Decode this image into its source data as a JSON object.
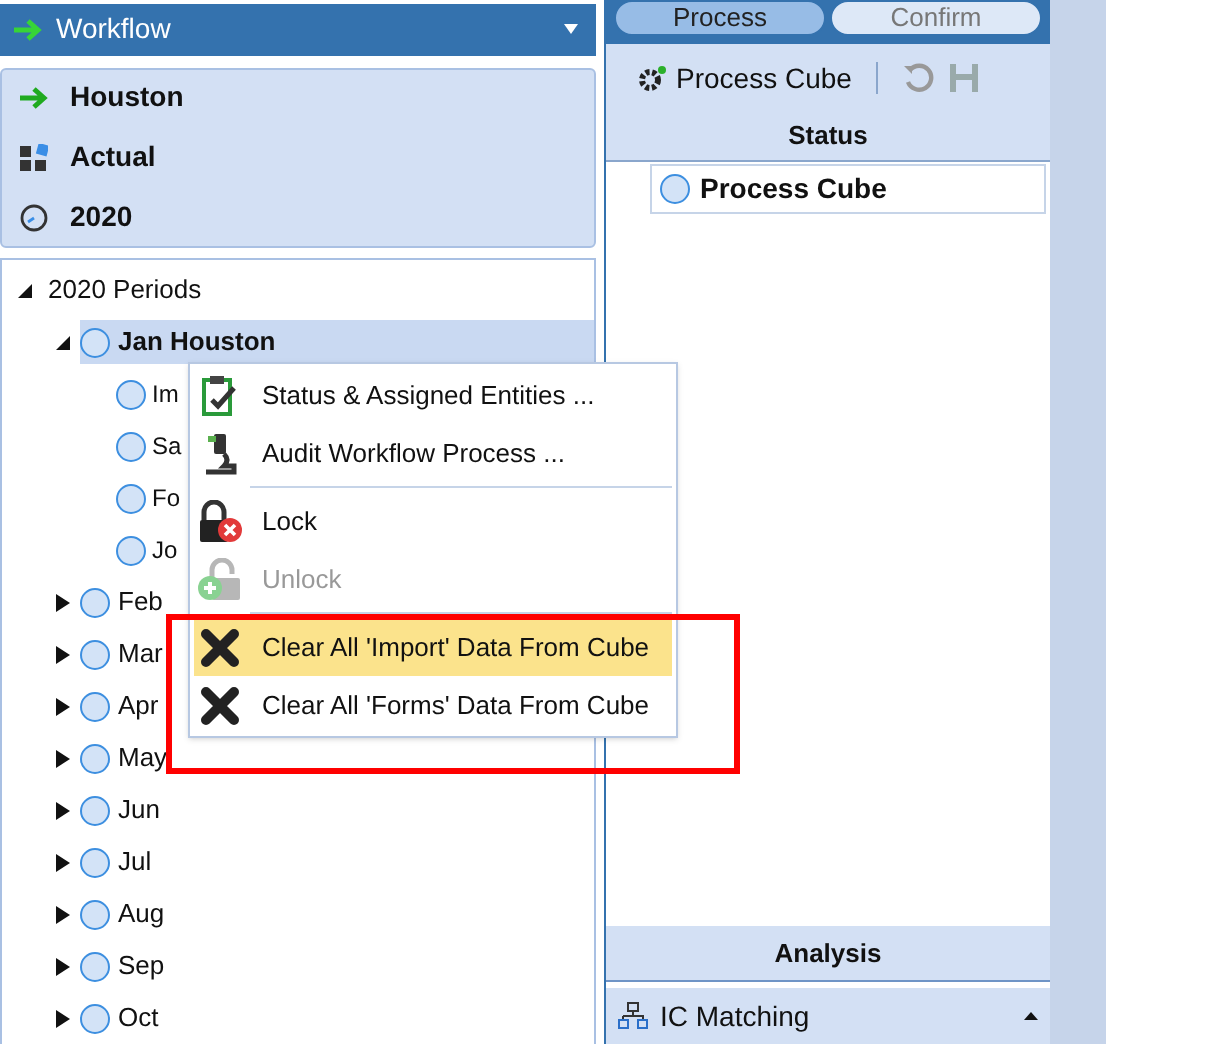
{
  "workflow_bar": {
    "title": "Workflow"
  },
  "info": [
    {
      "kind": "entity",
      "label": "Houston"
    },
    {
      "kind": "scenario",
      "label": "Actual"
    },
    {
      "kind": "time",
      "label": "2020"
    }
  ],
  "tree": {
    "label": "2020 Periods",
    "expanded": true,
    "children": [
      {
        "label": "Jan Houston",
        "expanded": true,
        "selected": true,
        "children": [
          {
            "label": "Im",
            "selected": false
          },
          {
            "label": "Sa",
            "selected": false
          },
          {
            "label": "Fo",
            "selected": false
          },
          {
            "label": "Jo",
            "selected": false
          }
        ]
      },
      {
        "label": "Feb",
        "expanded": false,
        "selected": false
      },
      {
        "label": "Mar",
        "expanded": false,
        "selected": false
      },
      {
        "label": "Apr",
        "expanded": false,
        "selected": false
      },
      {
        "label": "May",
        "expanded": false,
        "selected": false
      },
      {
        "label": "Jun",
        "expanded": false,
        "selected": false
      },
      {
        "label": "Jul",
        "expanded": false,
        "selected": false
      },
      {
        "label": "Aug",
        "expanded": false,
        "selected": false
      },
      {
        "label": "Sep",
        "expanded": false,
        "selected": false
      },
      {
        "label": "Oct",
        "expanded": false,
        "selected": false
      }
    ]
  },
  "context_menu": [
    {
      "kind": "status",
      "label": "Status & Assigned Entities ...",
      "disabled": false,
      "selected": false,
      "separator_before": false
    },
    {
      "kind": "audit",
      "label": "Audit Workflow Process ...",
      "disabled": false,
      "selected": false,
      "separator_before": false
    },
    {
      "kind": "lock",
      "label": "Lock",
      "disabled": false,
      "selected": false,
      "separator_before": true
    },
    {
      "kind": "unlock",
      "label": "Unlock",
      "disabled": true,
      "selected": false,
      "separator_before": false
    },
    {
      "kind": "clear",
      "label": "Clear All 'Import' Data From Cube",
      "disabled": false,
      "selected": true,
      "separator_before": true
    },
    {
      "kind": "clear",
      "label": "Clear All 'Forms' Data From Cube",
      "disabled": false,
      "selected": false,
      "separator_before": false
    }
  ],
  "tabs": [
    {
      "label": "Process",
      "selected": true
    },
    {
      "label": "Confirm",
      "selected": false
    }
  ],
  "toolbar": {
    "button": "Process Cube"
  },
  "status": {
    "header": "Status",
    "rows": [
      {
        "label": "Process Cube"
      }
    ]
  },
  "analysis": {
    "header": "Analysis",
    "item": "IC Matching"
  }
}
